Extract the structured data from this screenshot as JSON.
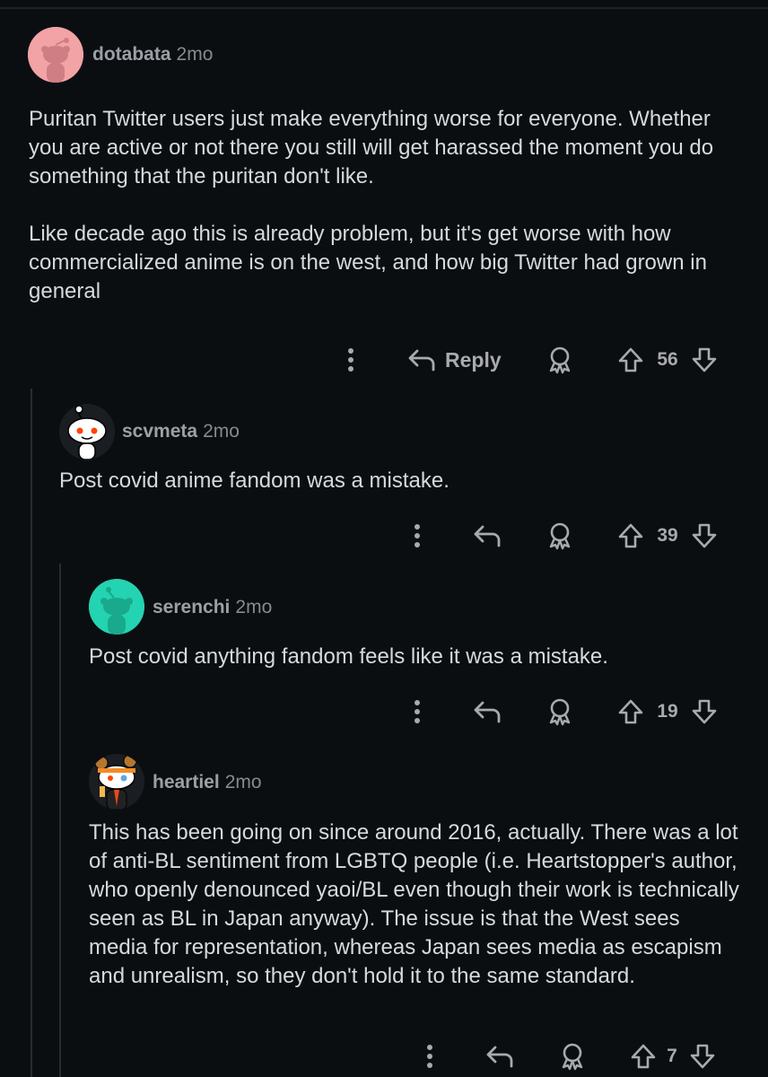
{
  "comments": [
    {
      "username": "dotabata",
      "age": "2mo",
      "avatar_color": "#f1a3a6",
      "paragraphs": [
        "Puritan Twitter users just make everything worse for everyone. Whether you are active or not there you still will get harassed the moment you do something that the puritan don't like.",
        "Like decade ago this is already problem, but it's get worse with how commercialized anime is on the west, and how big Twitter had grown in general"
      ],
      "reply_label": "Reply",
      "score": "56"
    },
    {
      "username": "scvmeta",
      "age": "2mo",
      "avatar_color": "#ffffff",
      "paragraphs": [
        "Post covid anime fandom was a mistake."
      ],
      "score": "39"
    },
    {
      "username": "serenchi",
      "age": "2mo",
      "avatar_color": "#24d3b1",
      "paragraphs": [
        "Post covid anything fandom feels like it was a mistake."
      ],
      "score": "19"
    },
    {
      "username": "heartiel",
      "age": "2mo",
      "avatar_color": "#ffffff",
      "paragraphs": [
        "This has been going on since around 2016, actually. There was a lot of anti-BL sentiment from LGBTQ people (i.e. Heartstopper's author, who openly denounced yaoi/BL even though their work is technically seen as BL in Japan anyway). The issue is that the West sees media for representation, whereas Japan sees media as escapism and unrealism, so they don't hold it to the same standard."
      ],
      "score": "7"
    }
  ],
  "icons": {
    "more": "more-options-icon",
    "reply": "reply-arrow-icon",
    "award": "award-icon",
    "upvote": "upvote-icon",
    "downvote": "downvote-icon"
  },
  "colors": {
    "background": "#0b0e11",
    "text": "#d7dadc",
    "muted": "#878a8c",
    "thread_line": "#2a2d30"
  }
}
